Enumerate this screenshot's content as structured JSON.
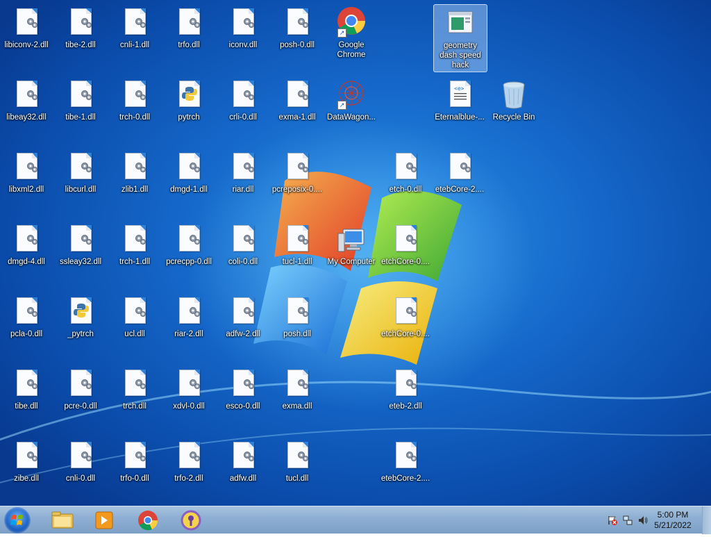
{
  "desktop": {
    "icons": [
      {
        "label": "libiconv-2.dll",
        "type": "dll"
      },
      {
        "label": "tibe-2.dll",
        "type": "dll"
      },
      {
        "label": "cnli-1.dll",
        "type": "dll"
      },
      {
        "label": "trfo.dll",
        "type": "dll"
      },
      {
        "label": "iconv.dll",
        "type": "dll"
      },
      {
        "label": "posh-0.dll",
        "type": "dll"
      },
      {
        "label": "Google Chrome",
        "type": "chrome-shortcut"
      },
      {
        "label": "geometry dash speed hack",
        "type": "app",
        "selected": true
      },
      {
        "label": "libeay32.dll",
        "type": "dll"
      },
      {
        "label": "tibe-1.dll",
        "type": "dll"
      },
      {
        "label": "trch-0.dll",
        "type": "dll"
      },
      {
        "label": "pytrch",
        "type": "python"
      },
      {
        "label": "crli-0.dll",
        "type": "dll"
      },
      {
        "label": "exma-1.dll",
        "type": "dll"
      },
      {
        "label": "DataWagon...",
        "type": "datawagon-shortcut"
      },
      {
        "label": "Eternalblue-...",
        "type": "xml"
      },
      {
        "label": "Recycle Bin",
        "type": "recycle-bin"
      },
      {
        "label": "libxml2.dll",
        "type": "dll"
      },
      {
        "label": "libcurl.dll",
        "type": "dll"
      },
      {
        "label": "zlib1.dll",
        "type": "dll"
      },
      {
        "label": "dmgd-1.dll",
        "type": "dll"
      },
      {
        "label": "riar.dll",
        "type": "dll"
      },
      {
        "label": "pcreposix-0....",
        "type": "dll"
      },
      {
        "label": "etch-0.dll",
        "type": "dll"
      },
      {
        "label": "etebCore-2....",
        "type": "dll"
      },
      {
        "label": "dmgd-4.dll",
        "type": "dll"
      },
      {
        "label": "ssleay32.dll",
        "type": "dll"
      },
      {
        "label": "trch-1.dll",
        "type": "dll"
      },
      {
        "label": "pcrecpp-0.dll",
        "type": "dll"
      },
      {
        "label": "coli-0.dll",
        "type": "dll"
      },
      {
        "label": "tucl-1.dll",
        "type": "dll"
      },
      {
        "label": "My Computer",
        "type": "computer"
      },
      {
        "label": "etchCore-0....",
        "type": "dll"
      },
      {
        "label": "pcla-0.dll",
        "type": "dll"
      },
      {
        "label": "_pytrch",
        "type": "python"
      },
      {
        "label": "ucl.dll",
        "type": "dll"
      },
      {
        "label": "riar-2.dll",
        "type": "dll"
      },
      {
        "label": "adfw-2.dll",
        "type": "dll"
      },
      {
        "label": "posh.dll",
        "type": "dll"
      },
      {
        "label": "etchCore-0....",
        "type": "dll"
      },
      {
        "label": "tibe.dll",
        "type": "dll"
      },
      {
        "label": "pcre-0.dll",
        "type": "dll"
      },
      {
        "label": "trch.dll",
        "type": "dll"
      },
      {
        "label": "xdvl-0.dll",
        "type": "dll"
      },
      {
        "label": "esco-0.dll",
        "type": "dll"
      },
      {
        "label": "exma.dll",
        "type": "dll"
      },
      {
        "label": "eteb-2.dll",
        "type": "dll"
      },
      {
        "label": "zibe.dll",
        "type": "dll"
      },
      {
        "label": "cnli-0.dll",
        "type": "dll"
      },
      {
        "label": "trfo-0.dll",
        "type": "dll"
      },
      {
        "label": "trfo-2.dll",
        "type": "dll"
      },
      {
        "label": "adfw.dll",
        "type": "dll"
      },
      {
        "label": "tucl.dll",
        "type": "dll"
      },
      {
        "label": "etebCore-2....",
        "type": "dll"
      }
    ]
  },
  "taskbar": {
    "start_icon": "windows-logo-icon",
    "pinned": [
      {
        "name": "file-explorer",
        "icon": "folder-icon"
      },
      {
        "name": "media-player",
        "icon": "media-player-icon"
      },
      {
        "name": "chrome",
        "icon": "chrome-icon"
      },
      {
        "name": "keyring-app",
        "icon": "key-shield-icon"
      }
    ],
    "tray_icons": [
      "action-center-flag-icon",
      "network-icon",
      "volume-icon"
    ],
    "clock": {
      "time": "5:00 PM",
      "date": "5/21/2022"
    }
  },
  "colors": {
    "accent": "#1466c8",
    "taskbar": "#8fb0d3"
  }
}
